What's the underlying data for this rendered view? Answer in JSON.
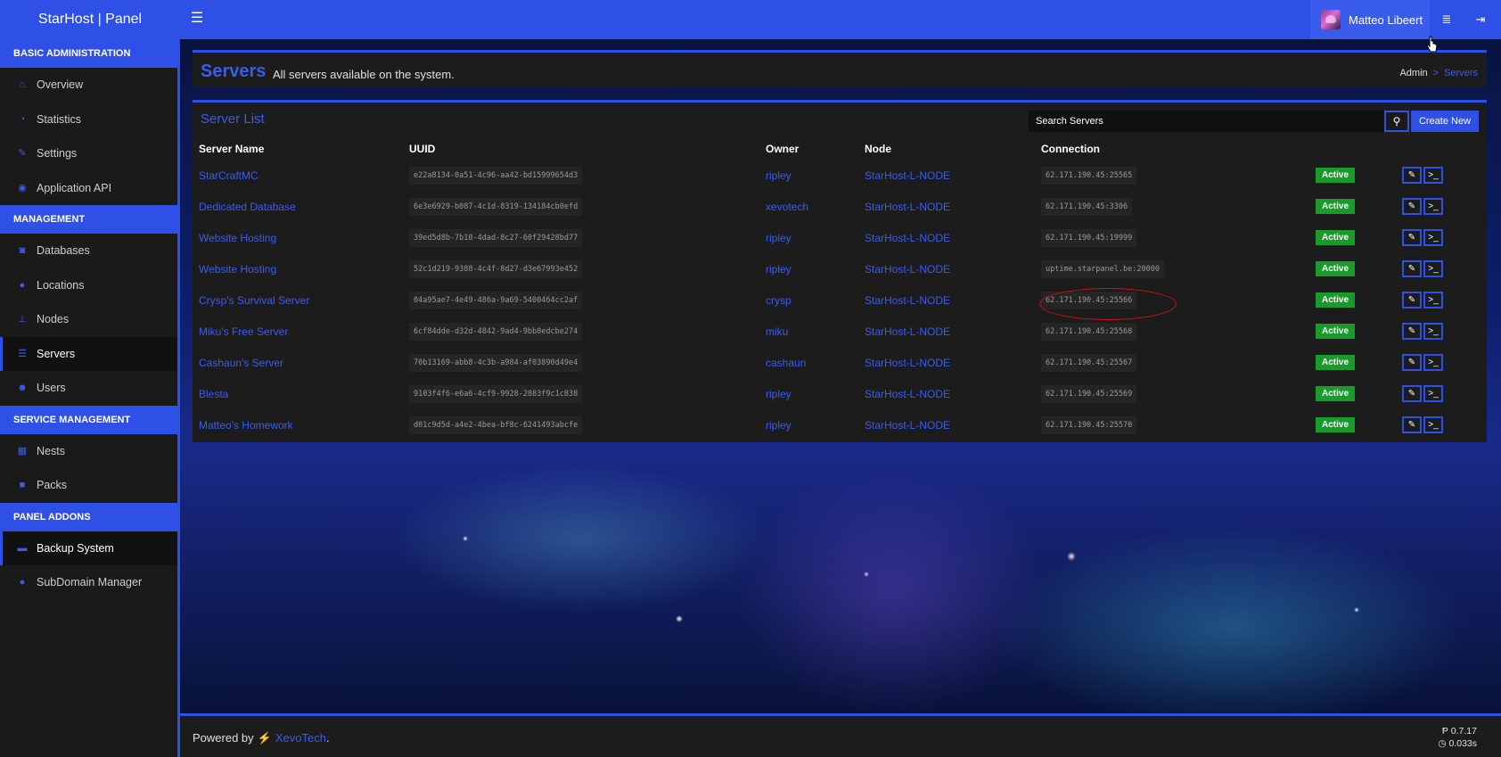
{
  "brand": "StarHost | Panel",
  "user": {
    "name": "Matteo Libeert"
  },
  "sidebar": {
    "sections": [
      {
        "header": "BASIC ADMINISTRATION",
        "items": [
          {
            "label": "Overview",
            "icon": "home-icon"
          },
          {
            "label": "Statistics",
            "icon": "gauge-icon"
          },
          {
            "label": "Settings",
            "icon": "wrench-icon"
          },
          {
            "label": "Application API",
            "icon": "gamepad-icon"
          }
        ]
      },
      {
        "header": "MANAGEMENT",
        "items": [
          {
            "label": "Databases",
            "icon": "database-icon"
          },
          {
            "label": "Locations",
            "icon": "globe-icon"
          },
          {
            "label": "Nodes",
            "icon": "sitemap-icon"
          },
          {
            "label": "Servers",
            "icon": "server-icon",
            "active": true
          },
          {
            "label": "Users",
            "icon": "users-icon"
          }
        ]
      },
      {
        "header": "SERVICE MANAGEMENT",
        "items": [
          {
            "label": "Nests",
            "icon": "th-large-icon"
          },
          {
            "label": "Packs",
            "icon": "archive-icon"
          }
        ]
      },
      {
        "header": "PANEL ADDONS",
        "items": [
          {
            "label": "Backup System",
            "icon": "folder-icon",
            "active": true
          },
          {
            "label": "SubDomain Manager",
            "icon": "globe-icon"
          }
        ]
      }
    ]
  },
  "header": {
    "title": "Servers",
    "subtitle": "All servers available on the system.",
    "breadcrumb": [
      "Admin",
      ">",
      "Servers"
    ]
  },
  "server_list": {
    "title": "Server List",
    "search_placeholder": "Search Servers",
    "create_label": "Create New",
    "columns": [
      "Server Name",
      "UUID",
      "Owner",
      "Node",
      "Connection"
    ],
    "rows": [
      {
        "name": "StarCraftMC",
        "uuid": "e22a8134-0a51-4c96-aa42-bd15999654d3",
        "owner": "ripley",
        "node": "StarHost-L-NODE",
        "connection": "62.171.190.45:25565",
        "status": "Active"
      },
      {
        "name": "Dedicated Database",
        "uuid": "6e3e6929-b087-4c1d-8319-134184cb0efd",
        "owner": "xevotech",
        "node": "StarHost-L-NODE",
        "connection": "62.171.190.45:3306",
        "status": "Active"
      },
      {
        "name": "Website Hosting",
        "uuid": "39ed5d8b-7b10-4dad-8c27-60f29428bd77",
        "owner": "ripley",
        "node": "StarHost-L-NODE",
        "connection": "62.171.190.45:19999",
        "status": "Active"
      },
      {
        "name": "Website Hosting",
        "uuid": "52c1d219-9388-4c4f-8d27-d3e67993e452",
        "owner": "ripley",
        "node": "StarHost-L-NODE",
        "connection": "uptime.starpanel.be:20000",
        "status": "Active"
      },
      {
        "name": "Crysp's Survival Server",
        "uuid": "04a95ae7-4e49-486a-9a69-5400464cc2af",
        "owner": "crysp",
        "node": "StarHost-L-NODE",
        "connection": "62.171.190.45:25566",
        "status": "Active"
      },
      {
        "name": "Miku's Free Server",
        "uuid": "6cf84dde-d32d-4842-9ad4-9bb8edcbe274",
        "owner": "miku",
        "node": "StarHost-L-NODE",
        "connection": "62.171.190.45:25568",
        "status": "Active"
      },
      {
        "name": "Cashaun's Server",
        "uuid": "70b13169-abb8-4c3b-a984-af03890d49e4",
        "owner": "cashaun",
        "node": "StarHost-L-NODE",
        "connection": "62.171.190.45:25567",
        "status": "Active"
      },
      {
        "name": "Blesta",
        "uuid": "9103f4f6-e6a6-4cf9-9928-2883f9c1c838",
        "owner": "ripley",
        "node": "StarHost-L-NODE",
        "connection": "62.171.190.45:25569",
        "status": "Active"
      },
      {
        "name": "Matteo's Homework",
        "uuid": "d01c9d5d-a4e2-4bea-bf8c-6241493abcfe",
        "owner": "ripley",
        "node": "StarHost-L-NODE",
        "connection": "62.171.190.45:25570",
        "status": "Active"
      }
    ]
  },
  "footer": {
    "powered_by": "Powered by",
    "brand": "XevoTech",
    "period": ".",
    "version": "0.7.17",
    "time": "0.033s"
  },
  "colors": {
    "accent": "#2f50e6",
    "status_active": "#1b9a2c",
    "annotation": "#d01010"
  }
}
